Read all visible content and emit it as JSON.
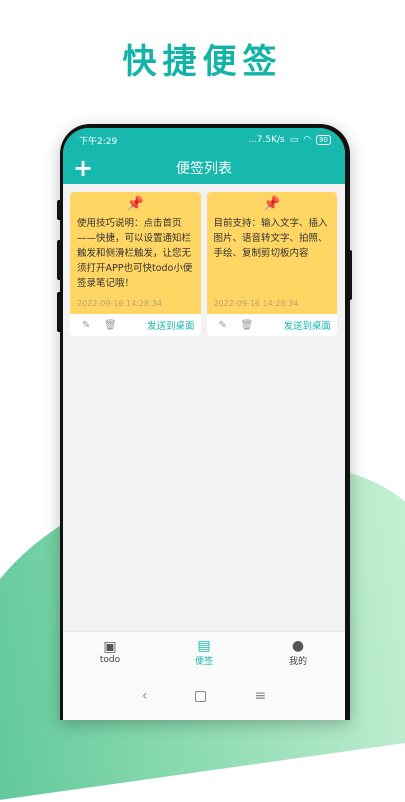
{
  "headline": "快捷便签",
  "status": {
    "time": "下午2:29",
    "net": "...7.5K/s",
    "battery": "90"
  },
  "appbar": {
    "title": "便签列表",
    "add": "+"
  },
  "notes": [
    {
      "pin": "📌",
      "text": "使用技巧说明：点击首页——快捷，可以设置通知栏触发和侧滑栏触发，让您无须打开APP也可快todo小便签录笔记哦！",
      "date": "2022-09-16 14:28:34",
      "edit": "✎",
      "delete": "🗑",
      "send": "发送到桌面"
    },
    {
      "pin": "📌",
      "text": "目前支持：输入文字、插入图片、语音转文字、拍照、手绘、复制剪切板内容",
      "date": "2022-09-16 14:28:34",
      "edit": "✎",
      "delete": "🗑",
      "send": "发送到桌面"
    }
  ],
  "nav": [
    {
      "label": "todo",
      "icon": "clipboard-check-icon",
      "glyph": "▣"
    },
    {
      "label": "便签",
      "icon": "note-icon",
      "glyph": "▤"
    },
    {
      "label": "我的",
      "icon": "user-icon",
      "glyph": "●"
    }
  ],
  "sysnav": {
    "back": "‹",
    "menu": "≡"
  },
  "colors": {
    "accent": "#17b8ad",
    "note": "#ffd664"
  }
}
